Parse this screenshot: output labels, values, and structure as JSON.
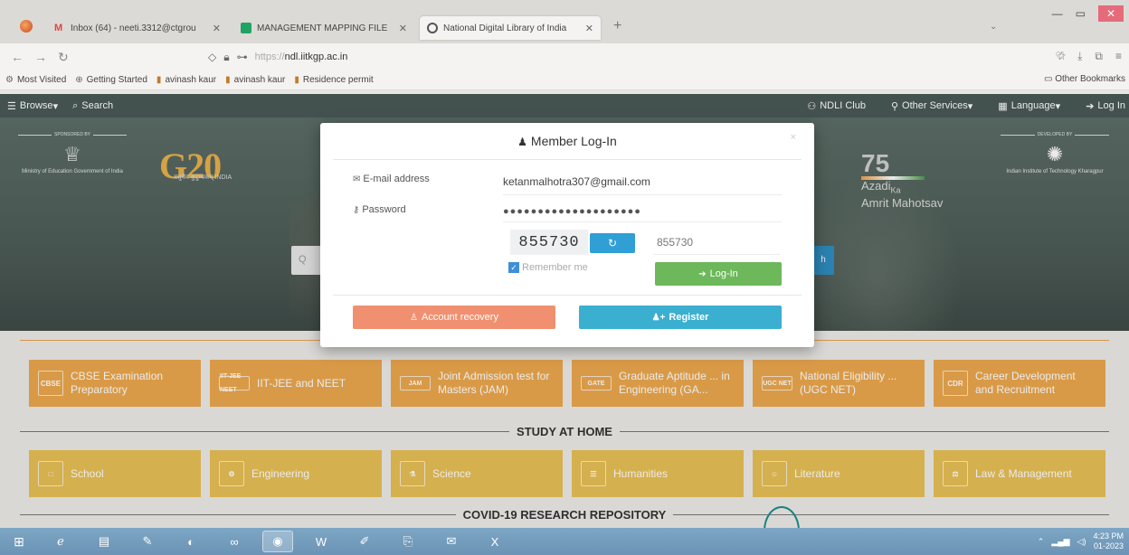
{
  "browser": {
    "tabs": [
      {
        "label": "Inbox (64) - neeti.3312@ctgrou",
        "icon": "gmail-icon",
        "active": false
      },
      {
        "label": "MANAGEMENT MAPPING FILE",
        "icon": "sheets-icon",
        "active": false
      },
      {
        "label": "National Digital Library of India",
        "icon": "globe-icon",
        "active": true
      }
    ],
    "new_tab": "+",
    "url_prefix": "https://",
    "url_host": "ndl.iitkgp.ac.in",
    "bookmarks": [
      {
        "label": "Most Visited",
        "icon": "gear-icon"
      },
      {
        "label": "Getting Started",
        "icon": "globe-icon"
      },
      {
        "label": "avinash kaur",
        "icon": "bookmark-icon"
      },
      {
        "label": "avinash kaur",
        "icon": "bookmark-icon"
      },
      {
        "label": "Residence permit",
        "icon": "bookmark-icon"
      }
    ],
    "other_bookmarks": "Other Bookmarks"
  },
  "site_nav": {
    "browse": "Browse",
    "search": "Search",
    "ndli_club": "NDLI Club",
    "other_services": "Other Services",
    "language": "Language",
    "login": "Log In"
  },
  "hero": {
    "sponsored_by": "SPONSORED BY",
    "ministry": "Ministry of Education Government of India",
    "g20_logo": "G20",
    "g20_sub": "वसुधैव कुटुम्बकम्  INDIA",
    "azadi_line1": "Azadi",
    "azadi_ka": "Ka",
    "azadi_line2": "Amrit",
    "azadi_line3": "Mahotsav",
    "azadi_num": "75",
    "developed_by": "DEVELOPED BY",
    "iit": "Indian Institute of Technology Kharagpur",
    "search_icon": "Q"
  },
  "modal": {
    "title": "Member Log-In",
    "close": "×",
    "email_label": "E-mail address",
    "email_value": "ketanmalhotra307@gmail.com",
    "password_label": "Password",
    "password_value": "●●●●●●●●●●●●●●●●●●●●",
    "captcha_image": "855730",
    "captcha_input": "855730",
    "remember_label": "Remember me",
    "login_button": "Log-In",
    "recovery_button": "Account recovery",
    "register_button": "Register"
  },
  "categories_top": [
    {
      "icon_text": "CBSE",
      "label": "CBSE Examination Preparatory"
    },
    {
      "icon_text": "IIT-JEE NEET",
      "label": "IIT-JEE and NEET"
    },
    {
      "icon_text": "JAM",
      "label": "Joint Admission test for Masters (JAM)"
    },
    {
      "icon_text": "GATE",
      "label": "Graduate Aptitude ... in Engineering (GA..."
    },
    {
      "icon_text": "UGC NET",
      "label": "National Eligibility ... (UGC NET)"
    },
    {
      "icon_text": "CDR",
      "label": "Career Development and Recruitment"
    }
  ],
  "section_study": "STUDY AT HOME",
  "categories_study": [
    {
      "icon_text": "□",
      "label": "School"
    },
    {
      "icon_text": "⚙",
      "label": "Engineering"
    },
    {
      "icon_text": "⚗",
      "label": "Science"
    },
    {
      "icon_text": "☰",
      "label": "Humanities"
    },
    {
      "icon_text": "☺",
      "label": "Literature"
    },
    {
      "icon_text": "⚖",
      "label": "Law & Management"
    }
  ],
  "section_covid": "COVID-19 RESEARCH REPOSITORY",
  "taskbar": {
    "clock_time": "4:23 PM",
    "clock_date": "01-2023"
  },
  "colors": {
    "accent_orange": "#eca84e",
    "accent_yellow": "#e8bf55",
    "login_green": "#6cb85a",
    "register_blue": "#3bafd0",
    "recovery_salmon": "#f09070",
    "site_bar": "#4a5a56"
  }
}
